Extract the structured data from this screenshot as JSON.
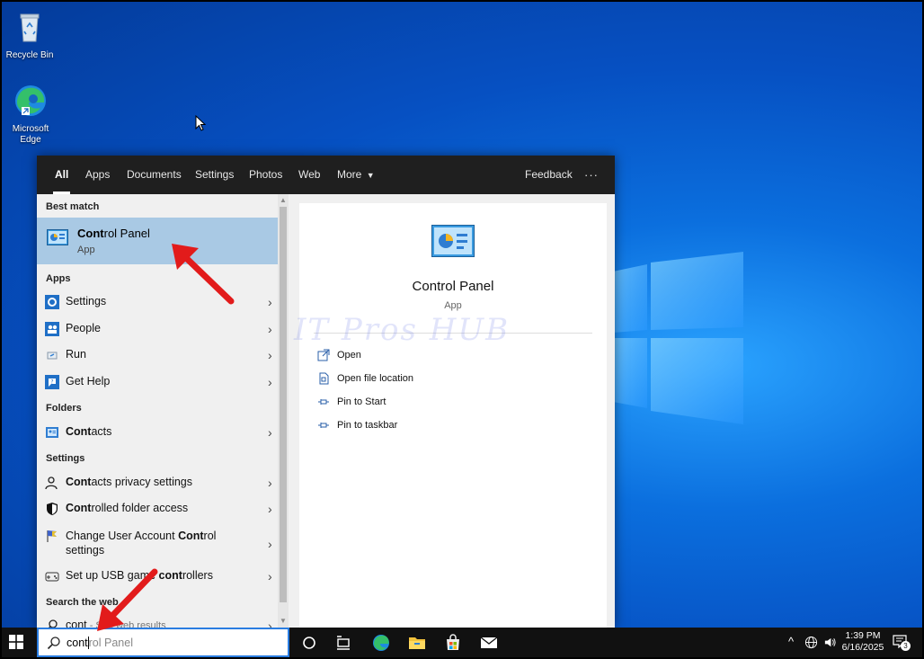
{
  "desktop": {
    "icons": [
      {
        "label": "Recycle Bin",
        "icon": "recycle-bin-icon"
      },
      {
        "label": "Microsoft Edge",
        "icon": "edge-icon"
      }
    ]
  },
  "search_panel": {
    "tabs": [
      {
        "label": "All",
        "active": true
      },
      {
        "label": "Apps"
      },
      {
        "label": "Documents"
      },
      {
        "label": "Settings"
      },
      {
        "label": "Photos"
      },
      {
        "label": "Web"
      },
      {
        "label": "More"
      }
    ],
    "feedback_label": "Feedback",
    "more_options_label": "···",
    "best_match": {
      "heading": "Best match",
      "title_bold": "Cont",
      "title_rest": "rol Panel",
      "subtitle": "App"
    },
    "apps_heading": "Apps",
    "apps": [
      {
        "bold": "",
        "rest": "Settings",
        "icon": "gear-icon"
      },
      {
        "bold": "",
        "rest": "People",
        "icon": "people-icon"
      },
      {
        "bold": "",
        "rest": "Run",
        "icon": "run-icon"
      },
      {
        "bold": "",
        "rest": "Get Help",
        "icon": "help-icon"
      }
    ],
    "folders_heading": "Folders",
    "folders": [
      {
        "bold": "Cont",
        "rest": "acts",
        "icon": "contacts-icon"
      }
    ],
    "settings_heading": "Settings",
    "settings": [
      {
        "pre": "",
        "bold": "Cont",
        "rest": "acts privacy settings",
        "icon": "person-icon"
      },
      {
        "pre": "",
        "bold": "Cont",
        "rest": "rolled folder access",
        "icon": "shield-icon"
      },
      {
        "pre": "Change User Account ",
        "bold": "Cont",
        "rest": "rol",
        "line2": "settings",
        "icon": "flag-icon"
      },
      {
        "pre": "Set up USB gam",
        "bold": "",
        "rest": "e ",
        "bold2": "cont",
        "rest2": "rollers",
        "icon": "gamepad-icon"
      }
    ],
    "web_heading": "Search the web",
    "web_row": {
      "query": "cont",
      "suffix": " - See web results"
    },
    "detail": {
      "title": "Control Panel",
      "subtitle": "App",
      "actions": [
        {
          "label": "Open",
          "icon": "open-icon"
        },
        {
          "label": "Open file location",
          "icon": "file-location-icon"
        },
        {
          "label": "Pin to Start",
          "icon": "pin-icon"
        },
        {
          "label": "Pin to taskbar",
          "icon": "pin-icon"
        }
      ]
    },
    "watermark": "IT Pros HUB"
  },
  "taskbar": {
    "search_typed": "cont",
    "search_suggest": "rol Panel",
    "time": "1:39 PM",
    "date": "6/16/2025",
    "notification_count": "3"
  },
  "colors": {
    "accent": "#2a7de1",
    "best_match_bg": "#a9c9e4",
    "annotation_arrow": "#e21b1b"
  }
}
